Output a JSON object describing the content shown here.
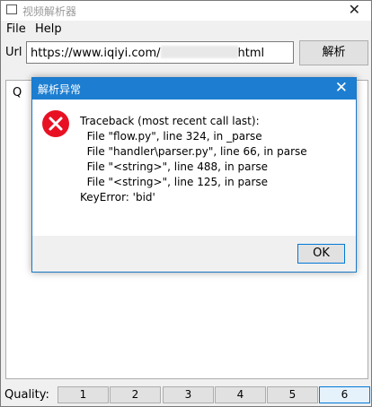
{
  "window": {
    "title": "视频解析器",
    "close_glyph": "✕"
  },
  "menu": {
    "file": "File",
    "help": "Help"
  },
  "url": {
    "label": "Url",
    "value_prefix": "https://www.iqiyi.com/",
    "value_suffix": "html"
  },
  "parse_button": "解析",
  "content": {
    "partial_text": "Q"
  },
  "quality": {
    "label": "Quality:",
    "options": [
      "1",
      "2",
      "3",
      "4",
      "5",
      "6"
    ],
    "selected": "6"
  },
  "dialog": {
    "title": "解析异常",
    "close_glyph": "✕",
    "icon": "error-icon",
    "lines": [
      "Traceback (most recent call last):",
      "  File \"flow.py\", line 324, in _parse",
      "  File \"handler\\parser.py\", line 66, in parse",
      "  File \"<string>\", line 488, in parse",
      "  File \"<string>\", line 125, in parse",
      "KeyError: 'bid'"
    ],
    "ok": "OK"
  },
  "colors": {
    "dialog_title": "#1d7ed1",
    "error_red": "#e81123",
    "focus_blue": "#0078d7"
  }
}
